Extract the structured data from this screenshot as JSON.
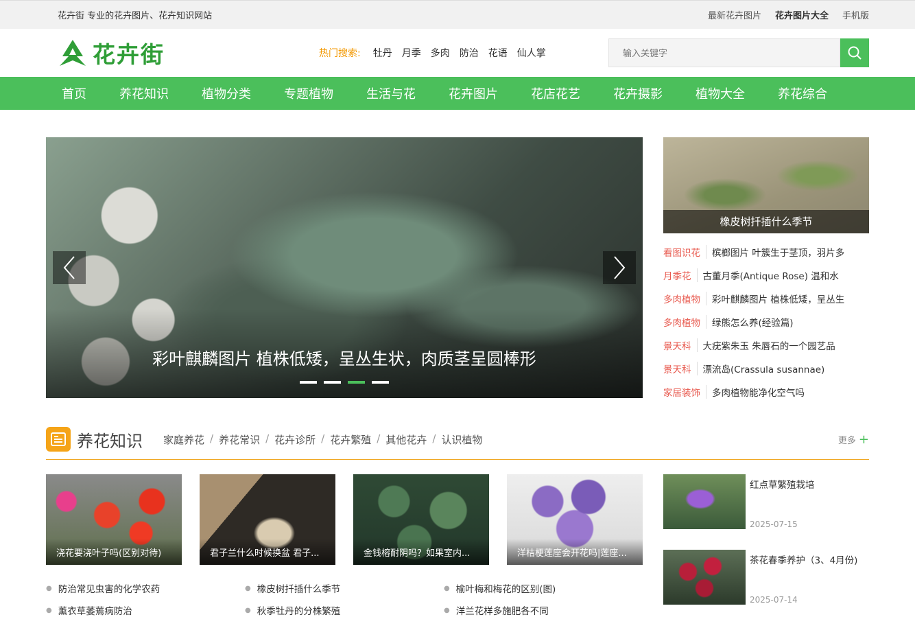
{
  "topbar": {
    "slogan": "花卉街 专业的花卉图片、花卉知识网站",
    "links": [
      "最新花卉图片",
      "花卉图片大全",
      "手机版"
    ]
  },
  "header": {
    "logo_text": "花卉街",
    "hot_label": "热门搜索:",
    "hot_items": [
      "牡丹",
      "月季",
      "多肉",
      "防治",
      "花语",
      "仙人掌"
    ],
    "search_placeholder": "输入关键字"
  },
  "nav": [
    "首页",
    "养花知识",
    "植物分类",
    "专题植物",
    "生活与花",
    "花卉图片",
    "花店花艺",
    "花卉摄影",
    "植物大全",
    "养花综合"
  ],
  "slider": {
    "caption": "彩叶麒麟图片 植株低矮，呈丛生状，肉质茎呈圆棒形",
    "active_dot": 3,
    "dot_count": 4
  },
  "side": {
    "feature_caption": "橡皮树扦插什么季节",
    "items": [
      {
        "tag": "看图识花",
        "title": "槟榔图片 叶簇生于茎顶，羽片多"
      },
      {
        "tag": "月季花",
        "title": "古董月季(Antique Rose) 温和水"
      },
      {
        "tag": "多肉植物",
        "title": "彩叶麒麟图片 植株低矮，呈丛生"
      },
      {
        "tag": "多肉植物",
        "title": "绿熊怎么养(经验篇)"
      },
      {
        "tag": "景天科",
        "title": "大疣紫朱玉 朱唇石的一个园艺品"
      },
      {
        "tag": "景天科",
        "title": "漂流岛(Crassula susannae)"
      },
      {
        "tag": "家居装饰",
        "title": "多肉植物能净化空气吗"
      }
    ]
  },
  "section": {
    "title": "养花知识",
    "links": [
      "家庭养花",
      "养花常识",
      "花卉诊所",
      "花卉繁殖",
      "其他花卉",
      "认识植物"
    ],
    "more": "更多",
    "thumbs": [
      "浇花要浇叶子吗(区别对待)",
      "君子兰什么时候换盆 君子...",
      "金钱榕耐阴吗？如果室内...",
      "洋桔梗莲座会开花吗|莲座..."
    ],
    "list": [
      "防治常见虫害的化学农药",
      "橡皮树扦插什么季节",
      "榆叶梅和梅花的区别(图)",
      "薰衣草萎蔫病防治",
      "秋季牡丹的分株繁殖",
      "洋兰花样多施肥各不同"
    ],
    "side_items": [
      {
        "title": "红点草繁殖栽培",
        "date": "2025-07-15"
      },
      {
        "title": "茶花春季养护（3、4月份)",
        "date": "2025-07-14"
      }
    ]
  },
  "colors": {
    "brand_green": "#4bbf5b",
    "accent_orange": "#f5a418",
    "tag_red": "#e85a4f"
  }
}
